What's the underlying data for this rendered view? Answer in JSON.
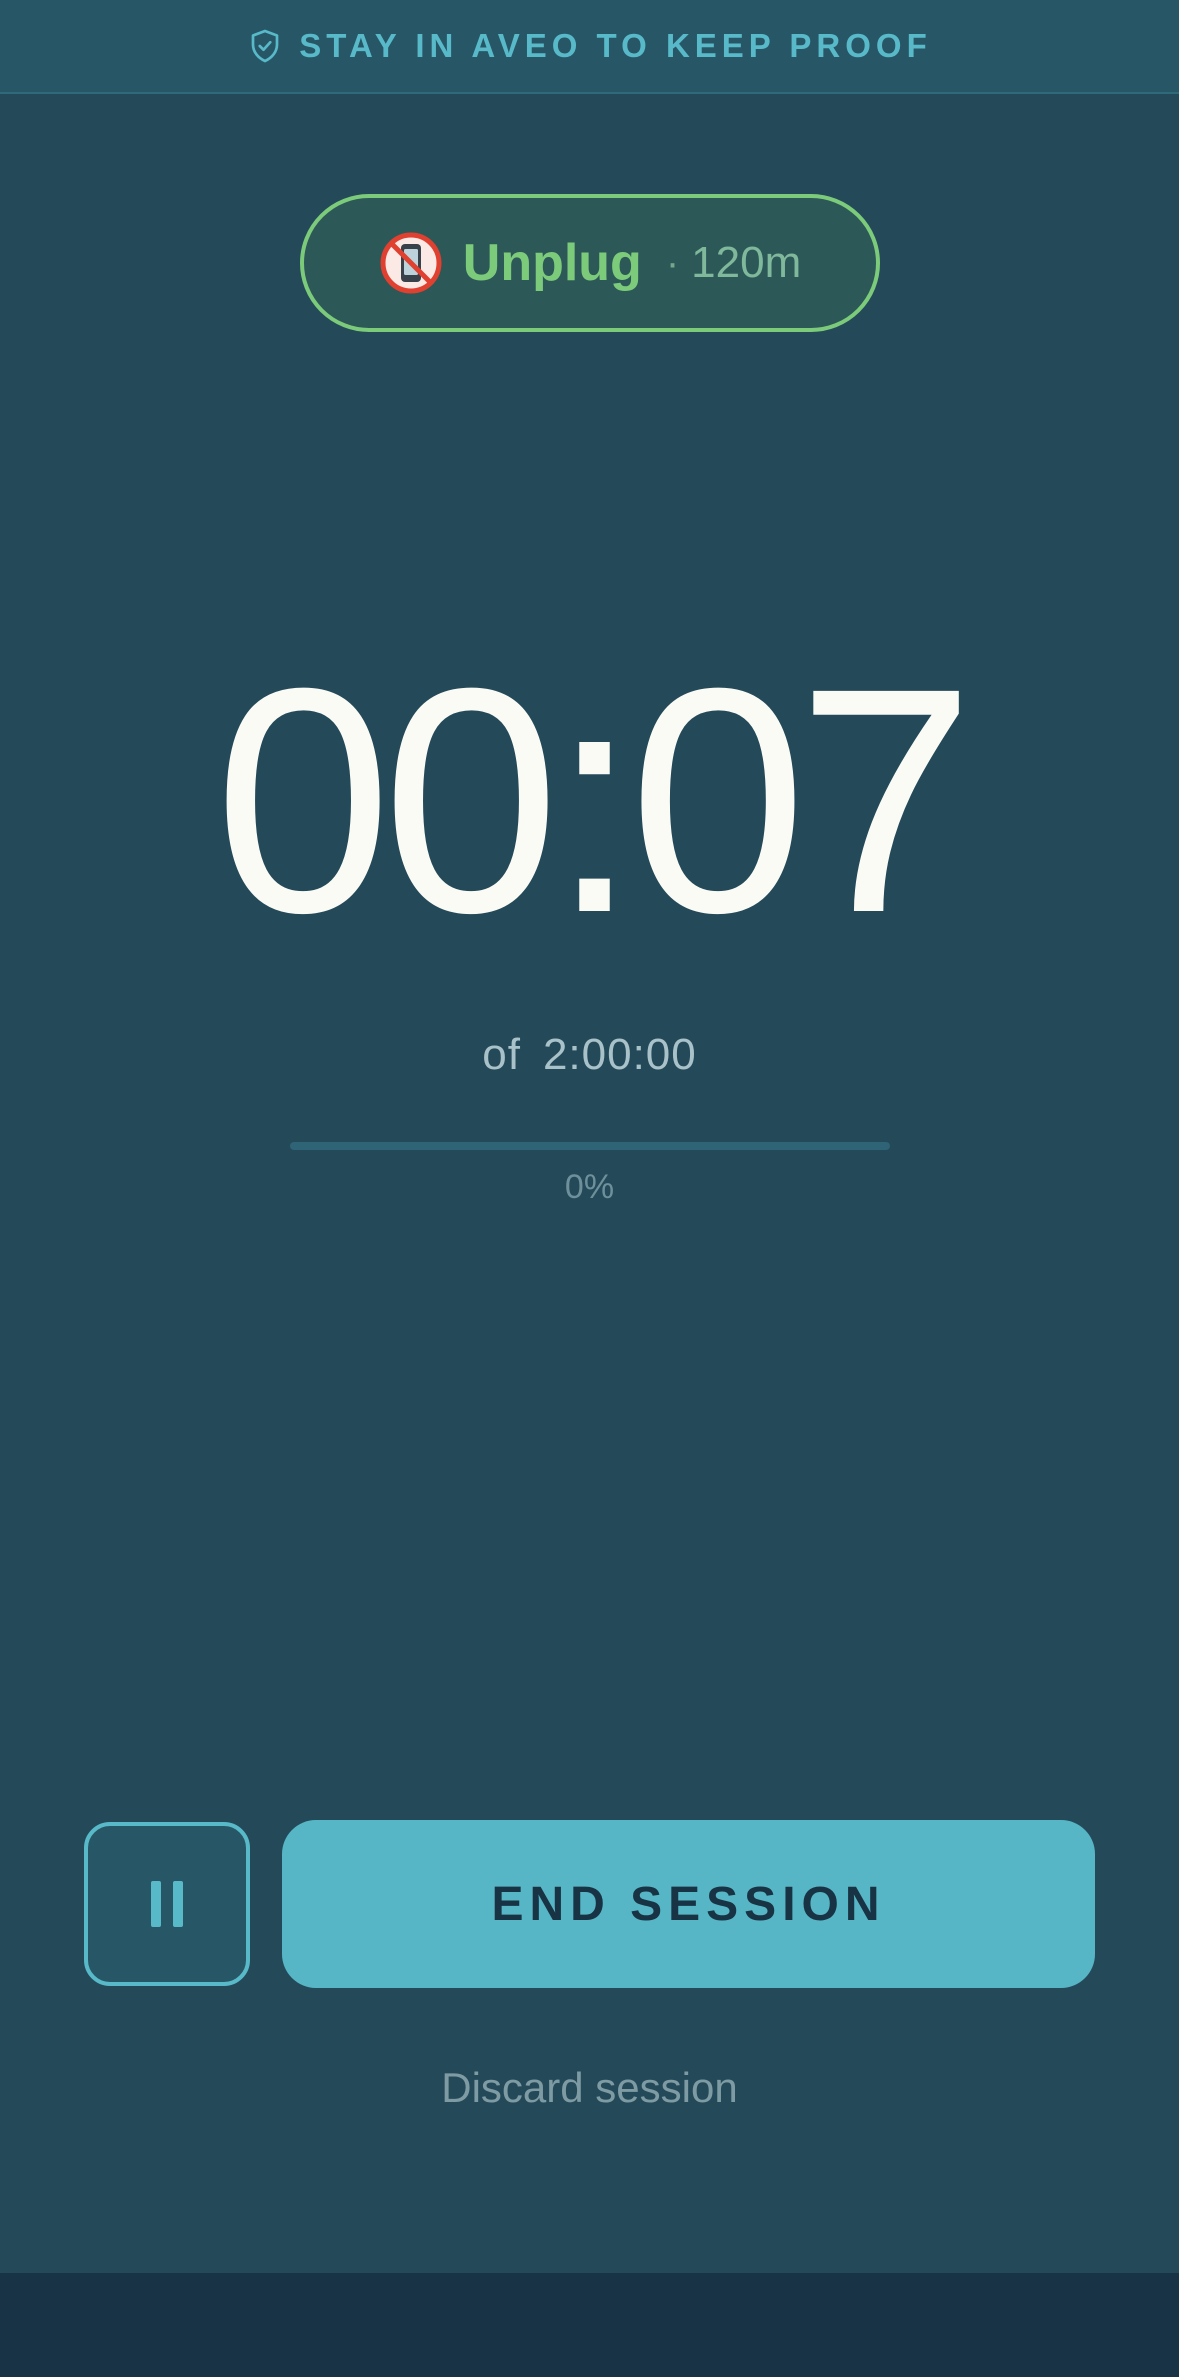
{
  "banner": {
    "text": "STAY IN AVEO TO KEEP PROOF",
    "icon": "shield-check-icon",
    "color": "#58b9c9"
  },
  "activity": {
    "icon": "no-phone-icon",
    "name": "Unplug",
    "separator": "·",
    "duration": "120m",
    "accent_color": "#7ccb7b"
  },
  "timer": {
    "elapsed": "00:07",
    "of_label": "of",
    "total": "2:00:00"
  },
  "progress": {
    "fraction": 0,
    "label": "0%"
  },
  "controls": {
    "pause_icon": "pause-icon",
    "end_label": "END SESSION",
    "discard_label": "Discard session"
  },
  "colors": {
    "background": "#244a5a",
    "primary": "#56b6c6",
    "button_text": "#173344"
  }
}
